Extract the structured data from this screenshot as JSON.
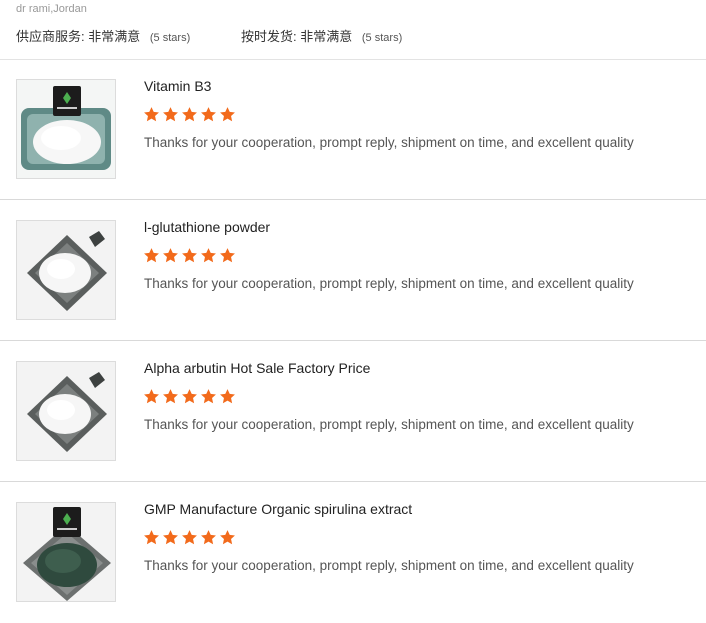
{
  "reviewer": "dr rami,Jordan",
  "ratings": [
    {
      "label": "供应商服务:",
      "value": "非常满意",
      "stars_text": "(5 stars)"
    },
    {
      "label": "按时发货:",
      "value": "非常满意",
      "stars_text": "(5 stars)"
    }
  ],
  "colors": {
    "star": "#f26a1b",
    "divider": "#d9d9d9"
  },
  "reviews": [
    {
      "title": "Vitamin B3",
      "rating": 5,
      "comment": "Thanks for your cooperation, prompt reply, shipment on time, and excellent quality",
      "image": "white-powder-in-teal-bowl-with-bag"
    },
    {
      "title": "l-glutathione powder",
      "rating": 5,
      "comment": "Thanks for your cooperation, prompt reply, shipment on time, and excellent quality",
      "image": "white-powder-on-grey-tray"
    },
    {
      "title": "Alpha arbutin Hot Sale Factory Price",
      "rating": 5,
      "comment": "Thanks for your cooperation, prompt reply, shipment on time, and excellent quality",
      "image": "white-powder-on-grey-tray"
    },
    {
      "title": "GMP Manufacture Organic spirulina extract",
      "rating": 5,
      "comment": "Thanks for your cooperation, prompt reply, shipment on time, and excellent quality",
      "image": "green-powder-on-grey-tray-with-bag"
    }
  ]
}
